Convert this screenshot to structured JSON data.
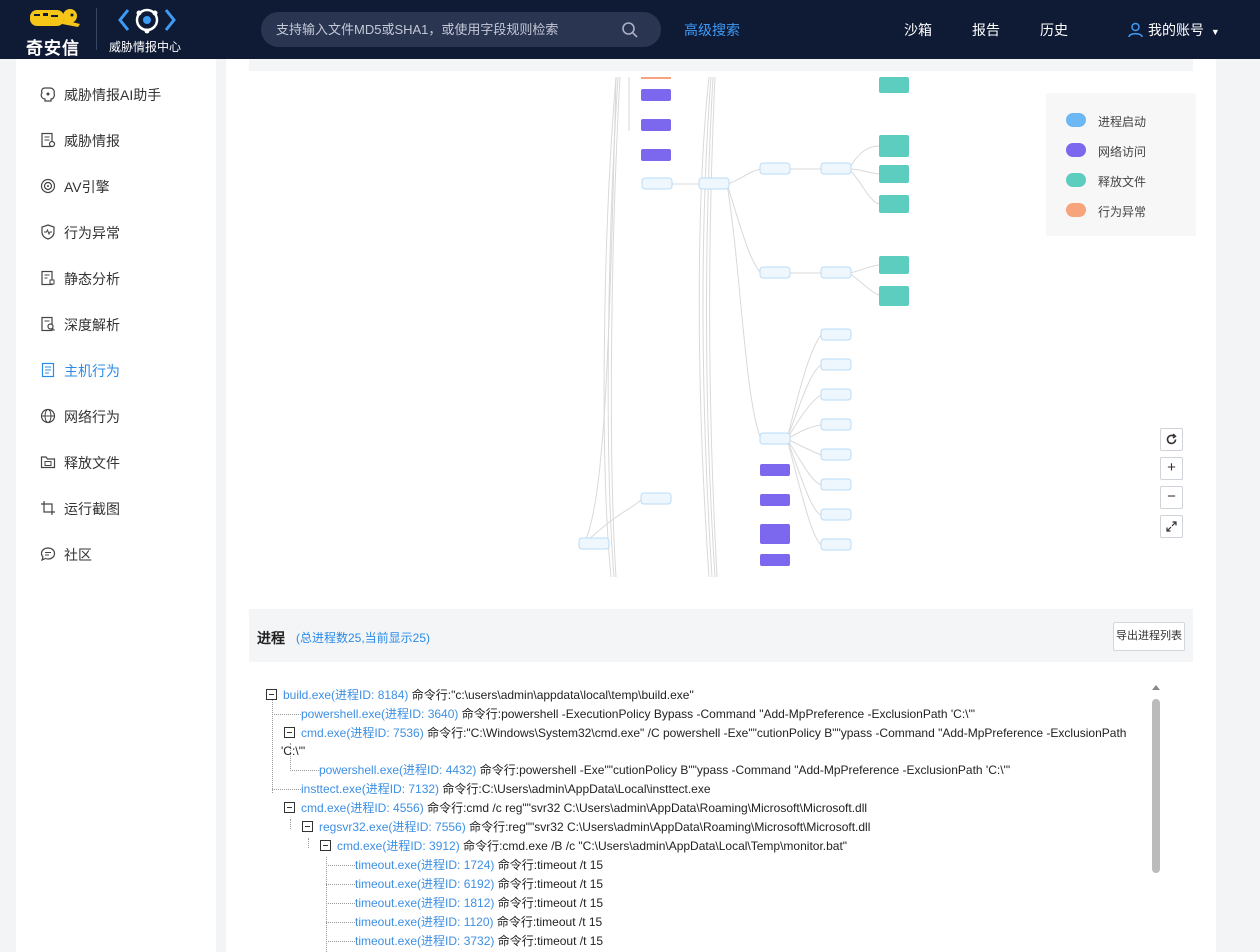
{
  "topbar": {
    "brand_name": "奇安信",
    "product_name": "威胁情报中心",
    "search_placeholder": "支持输入文件MD5或SHA1，或使用字段规则检索",
    "advanced_search": "高级搜索",
    "nav": [
      "沙箱",
      "报告",
      "历史"
    ],
    "account": "我的账号"
  },
  "sidebar": {
    "items": [
      {
        "label": "威胁情报AI助手",
        "icon": "ai-brain-icon"
      },
      {
        "label": "威胁情报",
        "icon": "intel-doc-icon"
      },
      {
        "label": "AV引擎",
        "icon": "target-icon"
      },
      {
        "label": "行为异常",
        "icon": "shield-pulse-icon"
      },
      {
        "label": "静态分析",
        "icon": "static-doc-icon"
      },
      {
        "label": "深度解析",
        "icon": "deep-doc-icon"
      },
      {
        "label": "主机行为",
        "icon": "host-doc-icon"
      },
      {
        "label": "网络行为",
        "icon": "globe-icon"
      },
      {
        "label": "释放文件",
        "icon": "folder-icon"
      },
      {
        "label": "运行截图",
        "icon": "crop-icon"
      },
      {
        "label": "社区",
        "icon": "chat-icon"
      }
    ],
    "active_index": 6,
    "active_color": "#2a8be8"
  },
  "legend": {
    "items": [
      {
        "label": "进程启动",
        "color": "#6cb8f5"
      },
      {
        "label": "网络访问",
        "color": "#7b68ee"
      },
      {
        "label": "释放文件",
        "color": "#5ccdbf"
      },
      {
        "label": "行为异常",
        "color": "#f7a47c"
      }
    ]
  },
  "graph_tools": [
    "refresh-icon",
    "zoom-in-icon",
    "zoom-out-icon",
    "fullscreen-icon"
  ],
  "process": {
    "title": "进程",
    "count_text": "(总进程数25,当前显示25)",
    "export_label": "导出进程列表",
    "nodes": [
      {
        "name": "build.exe(进程ID: 8184)",
        "cmd": "命令行:\"c:\\users\\admin\\appdata\\local\\temp\\build.exe\""
      },
      {
        "name": "powershell.exe(进程ID: 3640)",
        "cmd": "命令行:powershell -ExecutionPolicy Bypass -Command \"Add-MpPreference -ExclusionPath 'C:\\'\""
      },
      {
        "name": "cmd.exe(进程ID: 7536)",
        "cmd": "命令行:\"C:\\Windows\\System32\\cmd.exe\" /C powershell -Exe\"\"cutionPolicy B\"\"ypass -Command \"Add-MpPreference -ExclusionPath",
        "cmd_cont": "'C:\\'\""
      },
      {
        "name": "powershell.exe(进程ID: 4432)",
        "cmd": "命令行:powershell -Exe\"\"cutionPolicy B\"\"ypass -Command \"Add-MpPreference -ExclusionPath 'C:\\'\""
      },
      {
        "name": "insttect.exe(进程ID: 7132)",
        "cmd": "命令行:C:\\Users\\admin\\AppData\\Local\\insttect.exe"
      },
      {
        "name": "cmd.exe(进程ID: 4556)",
        "cmd": "命令行:cmd /c reg\"\"svr32 C:\\Users\\admin\\AppData\\Roaming\\Microsoft\\Microsoft.dll"
      },
      {
        "name": "regsvr32.exe(进程ID: 7556)",
        "cmd": "命令行:reg\"\"svr32 C:\\Users\\admin\\AppData\\Roaming\\Microsoft\\Microsoft.dll"
      },
      {
        "name": "cmd.exe(进程ID: 3912)",
        "cmd": "命令行:cmd.exe /B /c \"C:\\Users\\admin\\AppData\\Local\\Temp\\monitor.bat\""
      },
      {
        "name": "timeout.exe(进程ID: 1724)",
        "cmd": "命令行:timeout /t 15"
      },
      {
        "name": "timeout.exe(进程ID: 6192)",
        "cmd": "命令行:timeout /t 15"
      },
      {
        "name": "timeout.exe(进程ID: 1812)",
        "cmd": "命令行:timeout /t 15"
      },
      {
        "name": "timeout.exe(进程ID: 1120)",
        "cmd": "命令行:timeout /t 15"
      },
      {
        "name": "timeout.exe(进程ID: 3732)",
        "cmd": "命令行:timeout /t 15"
      }
    ]
  }
}
